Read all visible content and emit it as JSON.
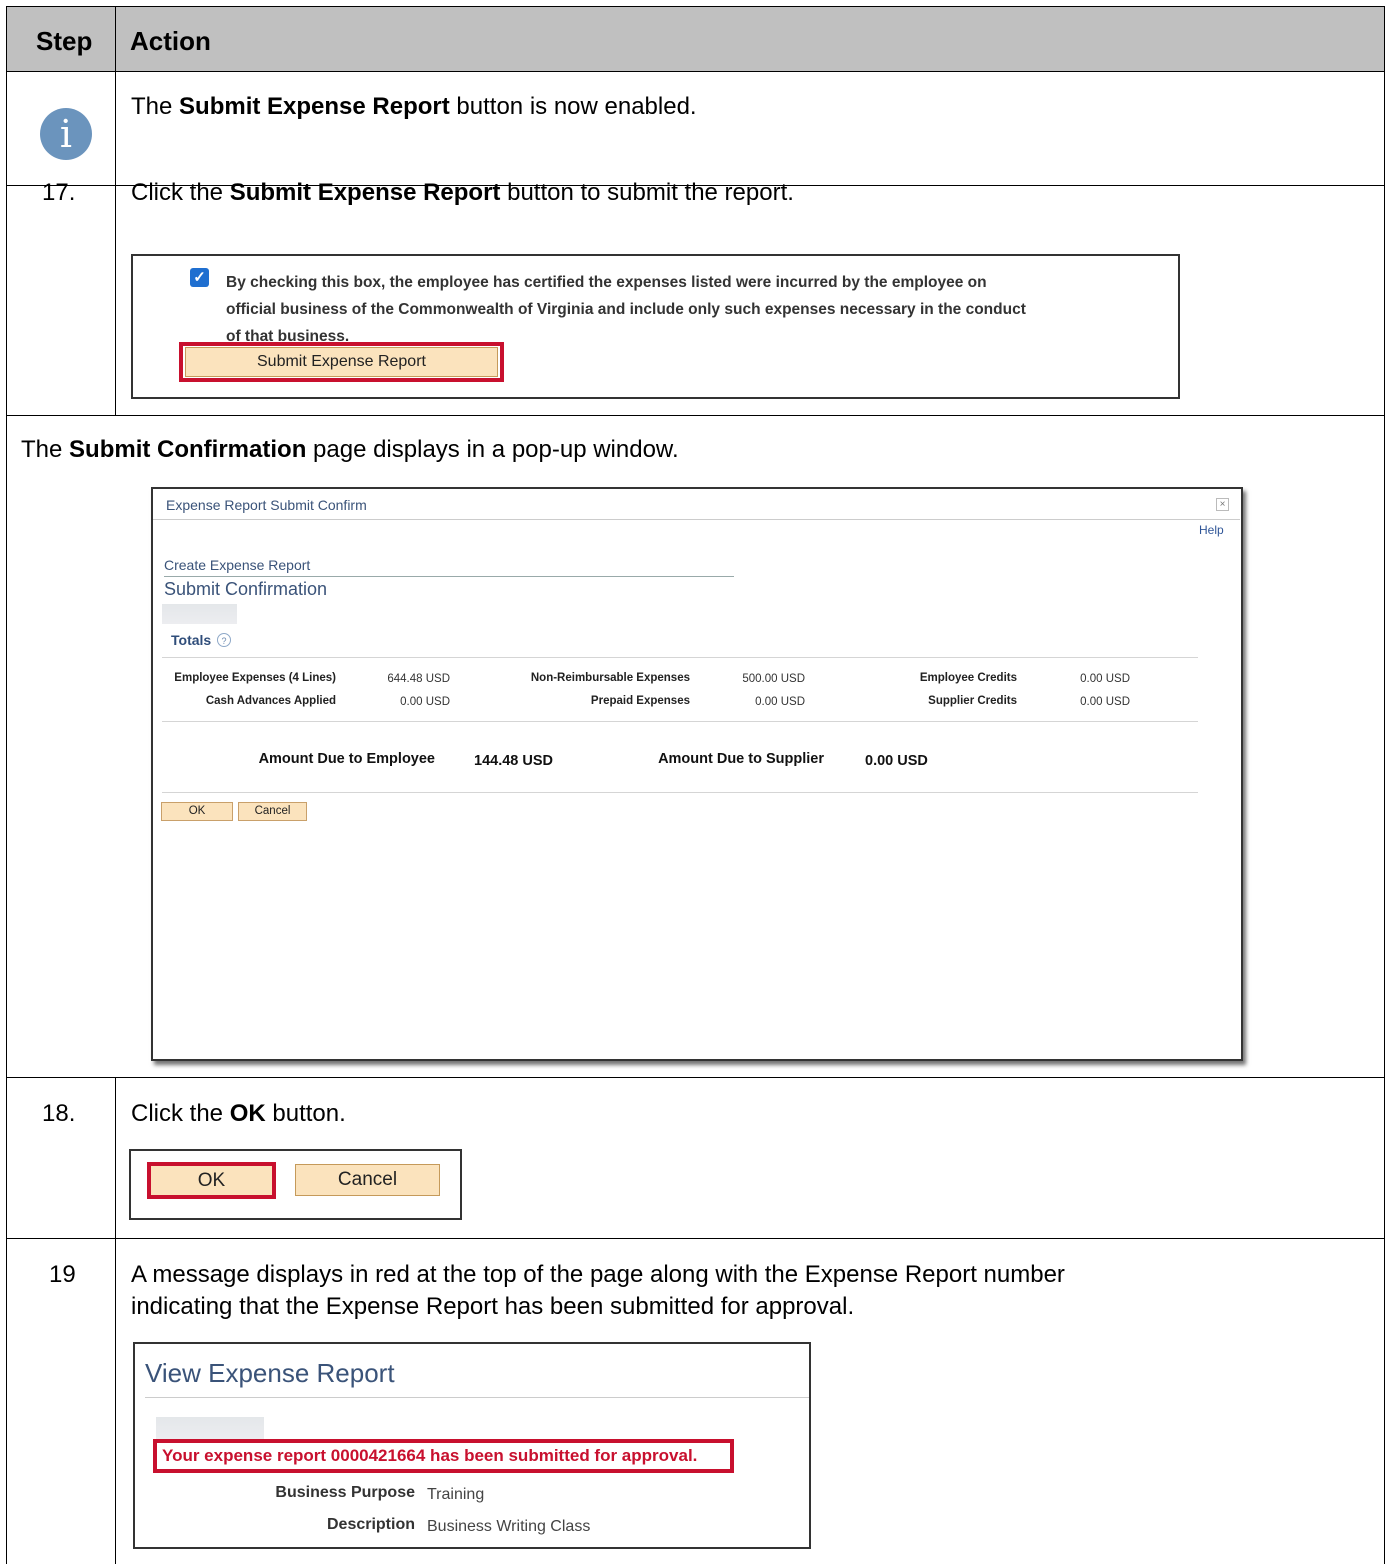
{
  "header": {
    "step": "Step",
    "action": "Action"
  },
  "info_row": {
    "icon": "info-icon",
    "icon_glyph": "i",
    "text_before": "The ",
    "text_bold": "Submit Expense Report",
    "text_after": " button is now enabled."
  },
  "step17": {
    "number": "17.",
    "text_before": "Click the ",
    "text_bold": "Submit Expense Report",
    "text_after": " button to submit the report.",
    "screenshot": {
      "checkbox_checked": true,
      "certification_lines": [
        "By checking this box, the employee has certified the expenses listed were incurred by the employee on",
        "official business of the Commonwealth of Virginia and include only such expenses necessary in the conduct",
        "of that business."
      ],
      "submit_button": "Submit Expense Report"
    }
  },
  "popup_row": {
    "text_before": "The ",
    "text_bold": "Submit Confirmation",
    "text_after": " page displays in a pop-up window.",
    "window": {
      "title": "Expense Report Submit Confirm",
      "close": "×",
      "help": "Help",
      "breadcrumb": "Create Expense Report",
      "page_title": "Submit Confirmation",
      "totals_label": "Totals",
      "help_glyph": "?",
      "employee_expenses_label": "Employee Expenses (4 Lines)",
      "employee_expenses_value": "644.48  USD",
      "cash_advances_label": "Cash Advances Applied",
      "cash_advances_value": "0.00  USD",
      "non_reimbursable_label": "Non-Reimbursable Expenses",
      "non_reimbursable_value": "500.00  USD",
      "prepaid_label": "Prepaid Expenses",
      "prepaid_value": "0.00  USD",
      "employee_credits_label": "Employee Credits",
      "employee_credits_value": "0.00  USD",
      "supplier_credits_label": "Supplier Credits",
      "supplier_credits_value": "0.00  USD",
      "amount_due_employee_label": "Amount Due to Employee",
      "amount_due_employee_value": "144.48  USD",
      "amount_due_supplier_label": "Amount Due to Supplier",
      "amount_due_supplier_value": "0.00  USD",
      "ok_button": "OK",
      "cancel_button": "Cancel"
    }
  },
  "step18": {
    "number": "18.",
    "text_before": "Click the ",
    "text_bold": "OK",
    "text_after": " button.",
    "ok_button": "OK",
    "cancel_button": "Cancel"
  },
  "step19": {
    "number": "19",
    "text_line1": "A message displays in red at the top of the page along with the Expense Report number",
    "text_line2": "indicating that the Expense Report has been submitted for approval.",
    "screenshot": {
      "title": "View Expense Report",
      "message": "Your expense report 0000421664 has been submitted for approval.",
      "business_purpose_label": "Business Purpose",
      "business_purpose_value": "Training",
      "description_label": "Description",
      "description_value": "Business Writing Class"
    }
  },
  "colors": {
    "header_bg": "#c0c0c0",
    "highlight": "#c8102e",
    "button_bg": "#fbe3bd",
    "title_blue": "#3a5379",
    "info_icon": "#6b94bd"
  }
}
